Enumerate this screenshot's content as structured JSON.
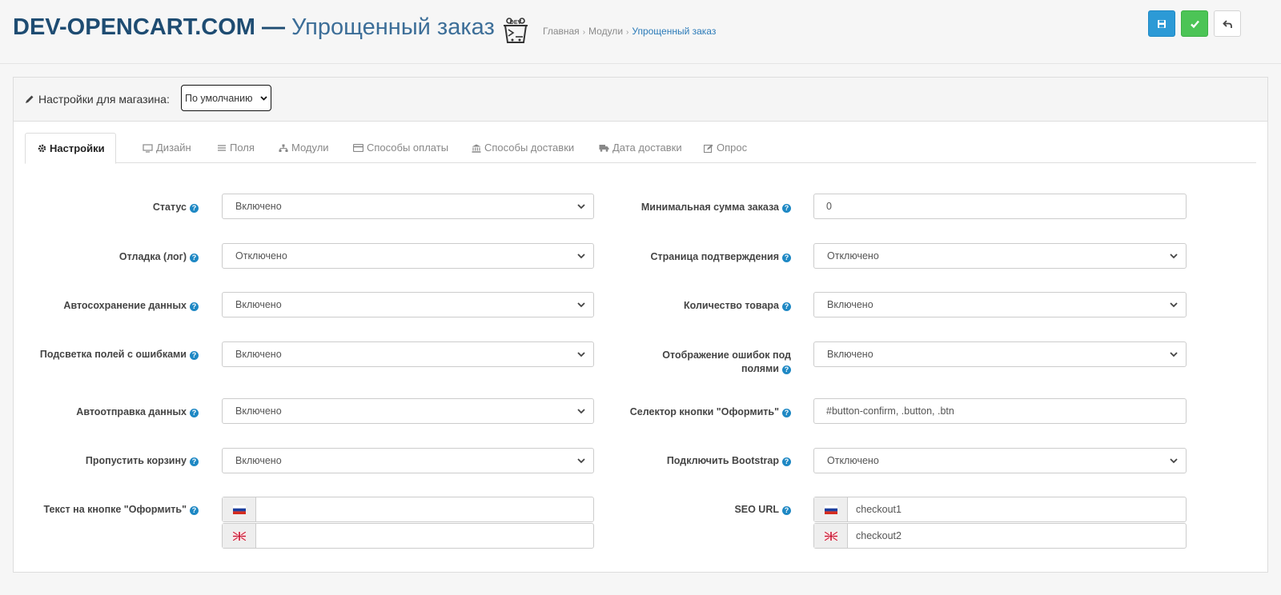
{
  "header": {
    "brand": "DEV-OPENCART.COM —",
    "module_title": "Упрощенный заказ",
    "logo_text": "DEV",
    "breadcrumbs": [
      "Главная",
      "Модули",
      "Упрощенный заказ"
    ],
    "colors": {
      "save": "#2c9ad6",
      "apply": "#4cc456",
      "title": "#1e4c72"
    }
  },
  "store": {
    "label": "Настройки для магазина:",
    "selected": "По умолчанию"
  },
  "tabs": [
    {
      "label": "Настройки",
      "icon": "gear-icon"
    },
    {
      "label": "Дизайн",
      "icon": "monitor-icon"
    },
    {
      "label": "Поля",
      "icon": "list-icon"
    },
    {
      "label": "Модули",
      "icon": "sitemap-icon"
    },
    {
      "label": "Способы оплаты",
      "icon": "credit-card-icon"
    },
    {
      "label": "Способы доставки",
      "icon": "bank-icon"
    },
    {
      "label": "Дата доставки",
      "icon": "truck-icon"
    },
    {
      "label": "Опрос",
      "icon": "edit-icon"
    }
  ],
  "left_fields": [
    {
      "label": "Статус",
      "value": "Включено"
    },
    {
      "label": "Отладка (лог)",
      "value": "Отключено"
    },
    {
      "label": "Автосохранение данных",
      "value": "Включено"
    },
    {
      "label": "Подсветка полей с ошибками",
      "value": "Включено"
    },
    {
      "label": "Автоотправка данных",
      "value": "Включено"
    },
    {
      "label": "Пропустить корзину",
      "value": "Включено"
    }
  ],
  "right_fields": [
    {
      "label": "Минимальная сумма заказа",
      "value": "0"
    },
    {
      "label": "Страница подтверждения",
      "value": "Отключено"
    },
    {
      "label": "Количество товара",
      "value": "Включено"
    },
    {
      "label_line1": "Отображение ошибок под",
      "label_line2": "полями",
      "value": "Включено"
    },
    {
      "label": "Селектор кнопки \"Оформить\"",
      "value": "#button-confirm, .button, .btn"
    },
    {
      "label": "Подключить Bootstrap",
      "value": "Отключено"
    }
  ],
  "button_text": {
    "label": "Текст на кнопке \"Оформить\"",
    "ru": "",
    "en": ""
  },
  "seo_url": {
    "label": "SEO URL",
    "ru": "checkout1",
    "en": "checkout2"
  }
}
